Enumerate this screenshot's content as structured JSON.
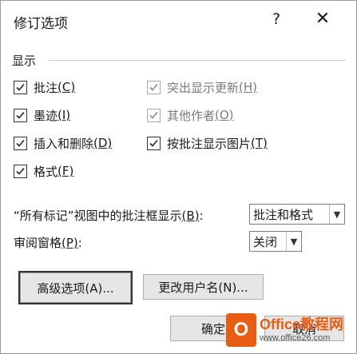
{
  "window": {
    "title": "修订选项",
    "help_label": "?",
    "close_label": "✕"
  },
  "display": {
    "section_label": "显示",
    "checkboxes": [
      {
        "text": "批注",
        "key": "(C)",
        "checked": true,
        "enabled": true
      },
      {
        "text": "突出显示更新",
        "key": "(H)",
        "checked": true,
        "enabled": false
      },
      {
        "text": "墨迹",
        "key": "(I)",
        "checked": true,
        "enabled": true
      },
      {
        "text": "其他作者",
        "key": "(O)",
        "checked": true,
        "enabled": false
      },
      {
        "text": "插入和删除",
        "key": "(D)",
        "checked": true,
        "enabled": true
      },
      {
        "text": "按批注显示图片",
        "key": "(T)",
        "checked": true,
        "enabled": true
      },
      {
        "text": "格式",
        "key": "(F)",
        "checked": true,
        "enabled": true
      }
    ]
  },
  "balloons": {
    "label": "“所有标记”视图中的批注框显示",
    "key": "(B)",
    "suffix": ":",
    "value": "批注和格式"
  },
  "reviewing_pane": {
    "label": "审阅窗格",
    "key": "(P)",
    "suffix": ":",
    "value": "关闭"
  },
  "buttons": {
    "advanced": "高级选项(A)...",
    "change_user": "更改用户名(N)...",
    "ok": "确定",
    "cancel": "取消"
  },
  "watermark": {
    "logo_letter": "O",
    "line1": "Office教程网",
    "line2": "www.office26.com"
  }
}
